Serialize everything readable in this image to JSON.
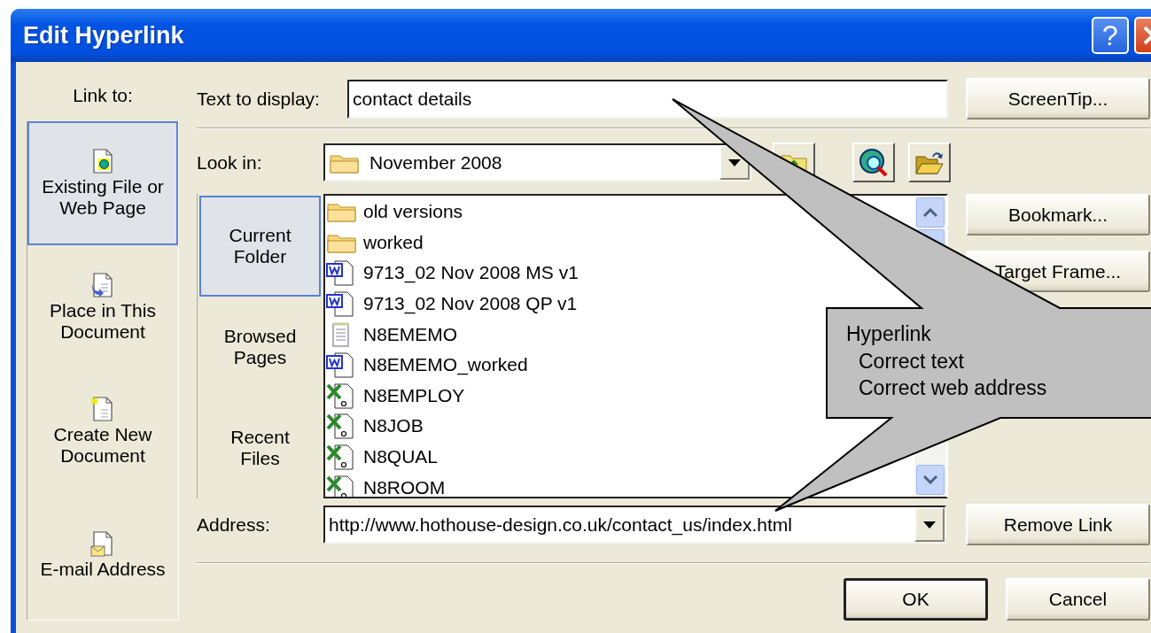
{
  "window": {
    "title": "Edit Hyperlink",
    "help_label": "?"
  },
  "link_to": {
    "label": "Link to:",
    "items": [
      {
        "kind": "existing",
        "label": "Existing File or\nWeb Page",
        "selected": true
      },
      {
        "kind": "place",
        "label": "Place in This\nDocument",
        "selected": false
      },
      {
        "kind": "new",
        "label": "Create New\nDocument",
        "selected": false
      },
      {
        "kind": "email",
        "label": "E-mail Address",
        "selected": false
      }
    ]
  },
  "text_to_display": {
    "label": "Text to display:",
    "value": "contact details"
  },
  "screentip_button": "ScreenTip...",
  "look_in": {
    "label": "Look in:",
    "value": "November 2008"
  },
  "browse_modes": [
    {
      "label": "Current\nFolder",
      "selected": true
    },
    {
      "label": "Browsed\nPages",
      "selected": false
    },
    {
      "label": "Recent\nFiles",
      "selected": false
    }
  ],
  "files": [
    {
      "kind": "folder",
      "name": "old versions"
    },
    {
      "kind": "folder",
      "name": "worked"
    },
    {
      "kind": "word",
      "name": "9713_02 Nov 2008 MS v1"
    },
    {
      "kind": "word",
      "name": "9713_02 Nov 2008 QP v1"
    },
    {
      "kind": "note",
      "name": "N8EMEMO"
    },
    {
      "kind": "word",
      "name": "N8EMEMO_worked"
    },
    {
      "kind": "excel",
      "name": "N8EMPLOY"
    },
    {
      "kind": "excel",
      "name": "N8JOB"
    },
    {
      "kind": "excel",
      "name": "N8QUAL"
    },
    {
      "kind": "excel",
      "name": "N8ROOM"
    }
  ],
  "side_buttons": [
    "Bookmark...",
    "Target Frame..."
  ],
  "address": {
    "label": "Address:",
    "value": "http://www.hothouse-design.co.uk/contact_us/index.html"
  },
  "remove_link_button": "Remove Link",
  "buttons": [
    {
      "label": "OK",
      "default": true
    },
    {
      "label": "Cancel",
      "default": false
    }
  ],
  "callout": {
    "title": "Hyperlink",
    "items": [
      "Correct text",
      "Correct web address"
    ]
  }
}
